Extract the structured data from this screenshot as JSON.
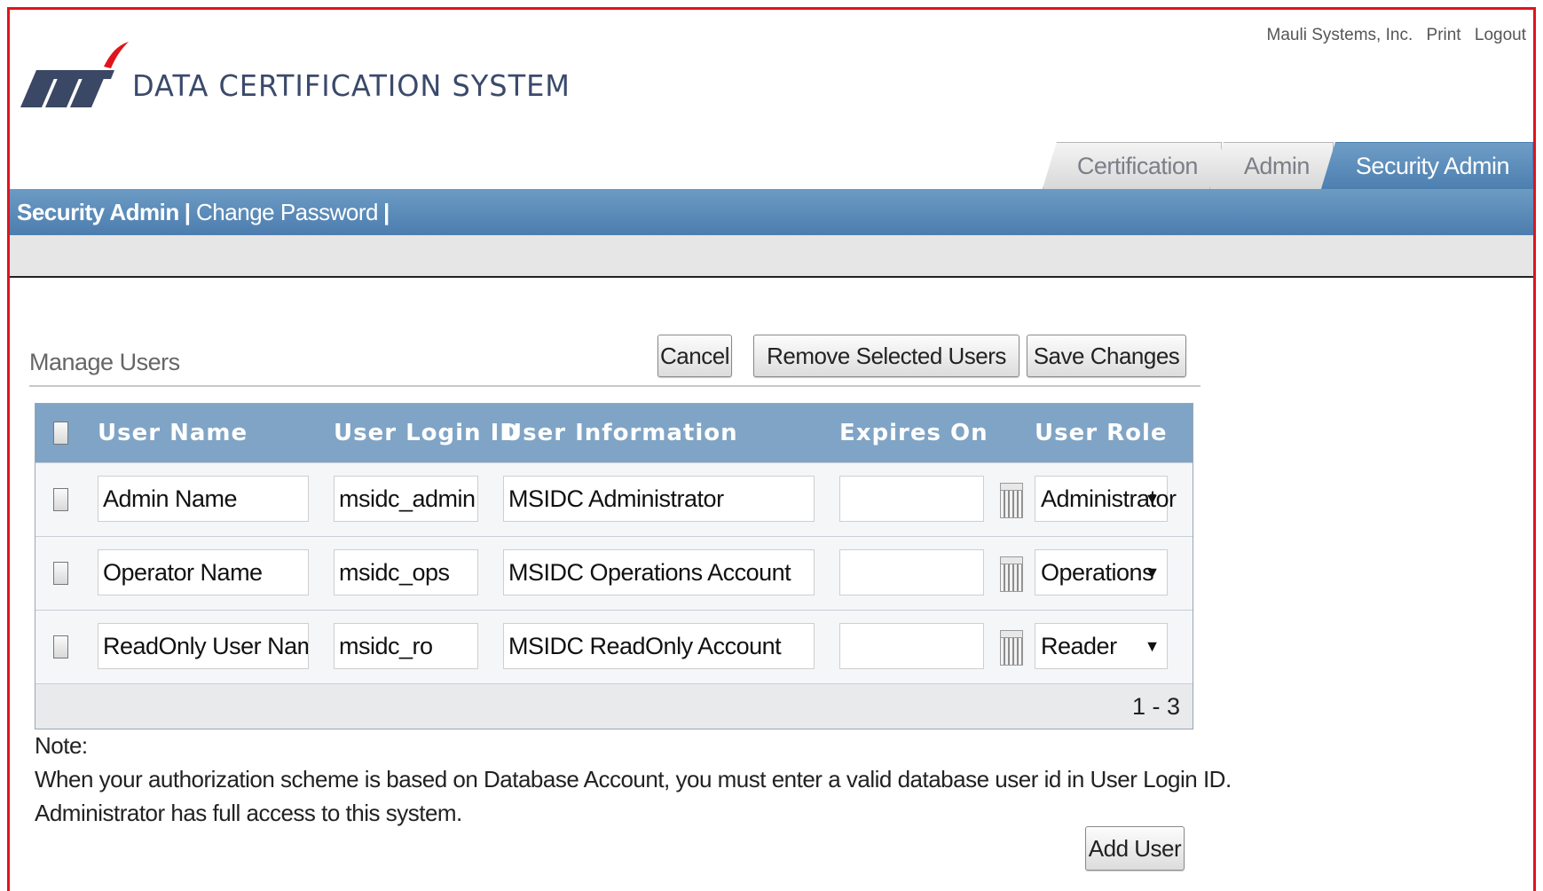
{
  "header": {
    "app_title": "DATA CERTIFICATION SYSTEM",
    "company": "Mauli Systems, Inc.",
    "print_link": "Print",
    "logout_link": "Logout"
  },
  "tabs": [
    {
      "label": "Certification",
      "active": false
    },
    {
      "label": "Admin",
      "active": false
    },
    {
      "label": "Security Admin",
      "active": true
    }
  ],
  "subnav": {
    "items": [
      {
        "label": "Security Admin",
        "active": true
      },
      {
        "label": "Change Password",
        "active": false
      }
    ],
    "separator": "|"
  },
  "section": {
    "title": "Manage Users",
    "buttons": {
      "cancel": "Cancel",
      "remove": "Remove Selected Users",
      "save": "Save Changes"
    }
  },
  "table": {
    "columns": [
      "User Name",
      "User Login ID",
      "User Information",
      "Expires On",
      "User Role"
    ],
    "rows": [
      {
        "name": "Admin Name",
        "login": "msidc_admin",
        "info": "MSIDC Administrator",
        "expires": "",
        "role": "Administrator"
      },
      {
        "name": "Operator Name",
        "login": "msidc_ops",
        "info": "MSIDC Operations Account",
        "expires": "",
        "role": "Operations"
      },
      {
        "name": "ReadOnly User Name",
        "login": "msidc_ro",
        "info": "MSIDC ReadOnly Account",
        "expires": "",
        "role": "Reader"
      }
    ],
    "pager": "1 - 3"
  },
  "note": {
    "label": "Note:",
    "line1": "When your authorization scheme is based on Database Account, you must enter a valid database user id in User Login ID.",
    "line2": "Administrator has full access to this system."
  },
  "add_user_label": "Add User",
  "colors": {
    "frame_border": "#e0141c",
    "nav_blue": "#5a89b8",
    "table_header": "#7fa4c6"
  }
}
